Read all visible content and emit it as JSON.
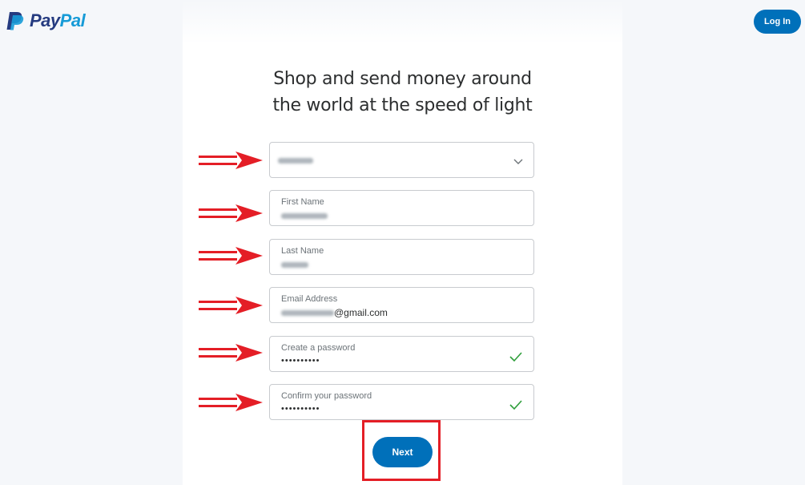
{
  "header": {
    "logo_pay": "Pay",
    "logo_pal": "Pal",
    "login_label": "Log In"
  },
  "headline": {
    "line1": "Shop and send money around",
    "line2": "the world at the speed of light"
  },
  "form": {
    "country": {
      "value_redacted": true
    },
    "first_name": {
      "label": "First Name"
    },
    "last_name": {
      "label": "Last Name"
    },
    "email": {
      "label": "Email Address",
      "visible_suffix": "@gmail.com"
    },
    "password": {
      "label": "Create a password",
      "value": "••••••••••",
      "valid": true
    },
    "confirm_password": {
      "label": "Confirm your password",
      "value": "••••••••••",
      "valid": true
    },
    "next_label": "Next"
  },
  "colors": {
    "brand_dark": "#253b80",
    "brand_light": "#179bd7",
    "button": "#0070ba",
    "annotation_red": "#e41e26",
    "check_green": "#2e9e3a"
  }
}
